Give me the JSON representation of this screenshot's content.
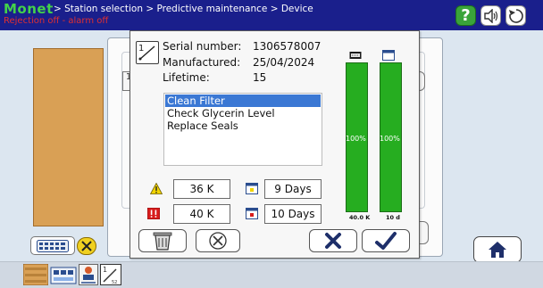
{
  "header": {
    "logo": "Monet",
    "breadcrumb": "> Station selection > Predictive maintenance > Device",
    "status": "Rejection off - alarm off",
    "help_label": "?"
  },
  "dialog": {
    "info": [
      {
        "label": "Serial number:",
        "value": "1306578007"
      },
      {
        "label": "Manufactured:",
        "value": "25/04/2024"
      },
      {
        "label": "Lifetime:",
        "value": "15"
      }
    ],
    "tasks": [
      {
        "label": "Clean Filter",
        "selected": true
      },
      {
        "label": "Check Glycerin Level",
        "selected": false
      },
      {
        "label": "Replace Seals",
        "selected": false
      }
    ],
    "warning": {
      "count": "36 K",
      "days": "9 Days"
    },
    "alarm": {
      "count": "40 K",
      "days": "10 Days"
    },
    "bars": [
      {
        "icon": "counter-icon",
        "fill_percent": 100,
        "percent_label": "100%",
        "footer": "40.0 K",
        "color": "#26ad20"
      },
      {
        "icon": "calendar-icon",
        "fill_percent": 100,
        "percent_label": "100%",
        "footer": "10 d",
        "color": "#26ad20"
      }
    ],
    "device_icon_label": "1"
  },
  "colors": {
    "header_bg": "#1a1f8c",
    "logo": "#43d14a",
    "status": "#e03030",
    "selected": "#3b78d4",
    "warning": "#f2d400",
    "alarm": "#d81c1c"
  },
  "background": {
    "left_tab_label": "1"
  },
  "bottom_strip": {
    "device_tab_label": "1",
    "device_tab_sub": "52"
  }
}
